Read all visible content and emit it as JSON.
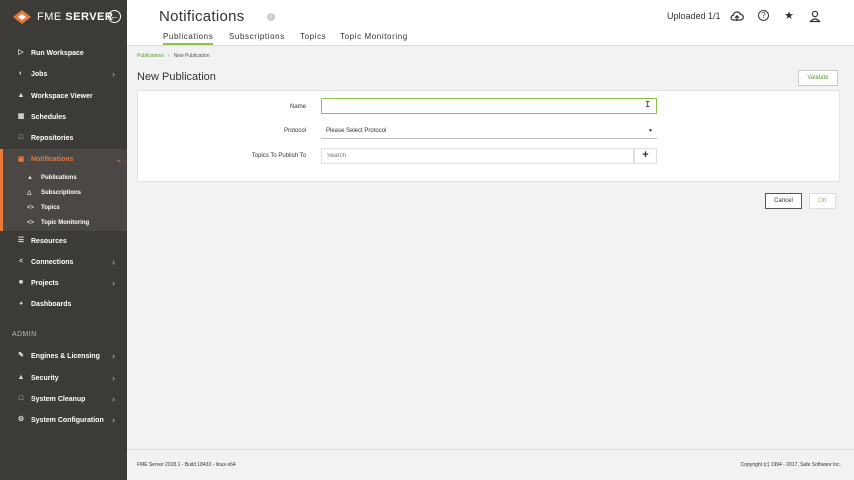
{
  "brand": {
    "name_thin": "FME",
    "name_bold": "SERVER"
  },
  "sidebar": {
    "items": [
      {
        "label": "Run Workspace",
        "icon": "play-icon",
        "chevron": false
      },
      {
        "label": "Jobs",
        "icon": "jobs-icon",
        "chevron": true
      },
      {
        "label": "Workspace Viewer",
        "icon": "workspace-viewer-icon",
        "chevron": false
      },
      {
        "label": "Schedules",
        "icon": "calendar-icon",
        "chevron": false
      },
      {
        "label": "Repositories",
        "icon": "folder-icon",
        "chevron": false
      },
      {
        "label": "Notifications",
        "icon": "notifications-icon",
        "chevron": true
      }
    ],
    "sub_items": [
      {
        "label": "Publications",
        "icon": "publication-icon"
      },
      {
        "label": "Subscriptions",
        "icon": "subscription-icon"
      },
      {
        "label": "Topics",
        "icon": "topic-icon"
      },
      {
        "label": "Topic Monitoring",
        "icon": "topic-monitoring-icon"
      }
    ],
    "items_after": [
      {
        "label": "Resources",
        "icon": "resources-icon",
        "chevron": false
      },
      {
        "label": "Connections",
        "icon": "connections-icon",
        "chevron": true
      },
      {
        "label": "Projects",
        "icon": "projects-icon",
        "chevron": true
      },
      {
        "label": "Dashboards",
        "icon": "dashboards-icon",
        "chevron": false
      }
    ],
    "admin_label": "ADMIN",
    "admin_items": [
      {
        "label": "Engines & Licensing",
        "icon": "engines-icon",
        "chevron": true
      },
      {
        "label": "Security",
        "icon": "shield-icon",
        "chevron": true
      },
      {
        "label": "System Cleanup",
        "icon": "cleanup-icon",
        "chevron": true
      },
      {
        "label": "System Configuration",
        "icon": "gear-icon",
        "chevron": true
      }
    ]
  },
  "header": {
    "title": "Notifications",
    "uploaded": "Uploaded 1/1",
    "tabs": [
      "Publications",
      "Subscriptions",
      "Topics",
      "Topic Monitoring"
    ],
    "active_tab": "Publications"
  },
  "breadcrumb": {
    "parent": "Publications",
    "current": "New Publication"
  },
  "form": {
    "title": "New Publication",
    "validate_label": "Validate",
    "name_label": "Name",
    "name_value": "",
    "protocol_label": "Protocol",
    "protocol_value": "Please Select Protocol",
    "topics_label": "Topics To Publish To",
    "topics_placeholder": "Search",
    "add_label": "+",
    "cancel_label": "Cancel",
    "ok_label": "OK"
  },
  "footer": {
    "left": "FME Server 2018.1 - Build 18433 - linux-x64",
    "right": "Copyright (c) 1994 - 2017, Safe Software Inc."
  },
  "colors": {
    "accent_orange": "#e8793a",
    "accent_green": "#8bc34a",
    "sidebar_bg": "#3d3b38"
  }
}
